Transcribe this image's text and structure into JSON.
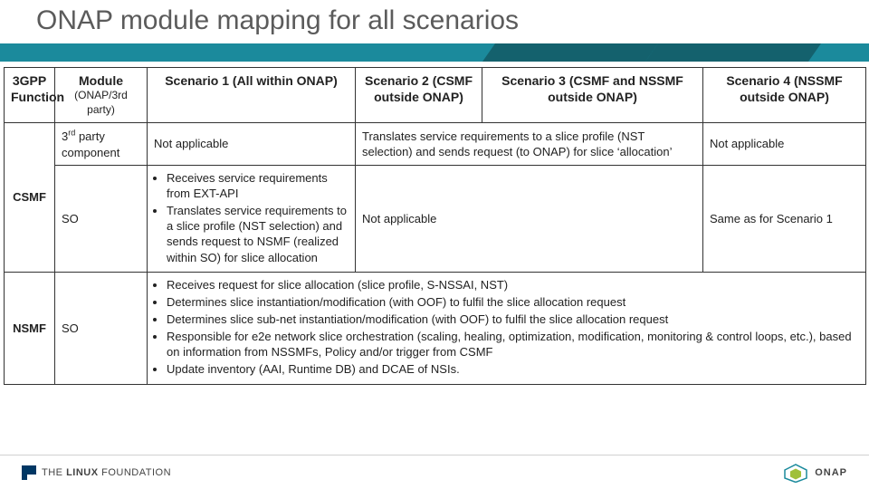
{
  "title": "ONAP module mapping for all scenarios",
  "headers": {
    "c0": "3GPP Function",
    "c1_main": "Module",
    "c1_sub": "(ONAP/3rd party)",
    "c2": "Scenario 1 (All within ONAP)",
    "c3": "Scenario 2 (CSMF outside ONAP)",
    "c4": "Scenario 3 (CSMF and NSSMF outside ONAP)",
    "c5": "Scenario 4 (NSSMF outside ONAP)"
  },
  "rows": {
    "csmf_label": "CSMF",
    "third_party_module": "3rd party component",
    "third_party_s1": "Not applicable",
    "third_party_s23": "Translates service requirements to a slice profile (NST selection) and sends request (to ONAP) for slice ‘allocation’",
    "third_party_s4": "Not applicable",
    "so_module": "SO",
    "so_s1_bullets": [
      "Receives service requirements from EXT-API",
      "Translates service requirements to a slice profile (NST selection) and sends request to NSMF (realized within SO) for slice allocation"
    ],
    "so_s23": "Not applicable",
    "so_s4": "Same as for Scenario 1",
    "nsmf_label": "NSMF",
    "nsmf_module": "SO",
    "nsmf_bullets": [
      "Receives request for slice allocation (slice profile,  S-NSSAI,  NST)",
      "Determines slice instantiation/modification (with OOF) to fulfil the slice allocation request",
      "Determines slice sub-net instantiation/modification (with OOF) to fulfil the slice allocation request",
      "Responsible for e2e network slice orchestration (scaling, healing, optimization, modification, monitoring & control loops, etc.), based on information from NSSMFs, Policy and/or trigger from CSMF",
      "Update inventory (AAI, Runtime DB) and DCAE of NSIs."
    ]
  },
  "footer": {
    "linux_light": "THE",
    "linux_bold": "LINUX",
    "linux_tail": "FOUNDATION",
    "onap": "ONAP"
  }
}
